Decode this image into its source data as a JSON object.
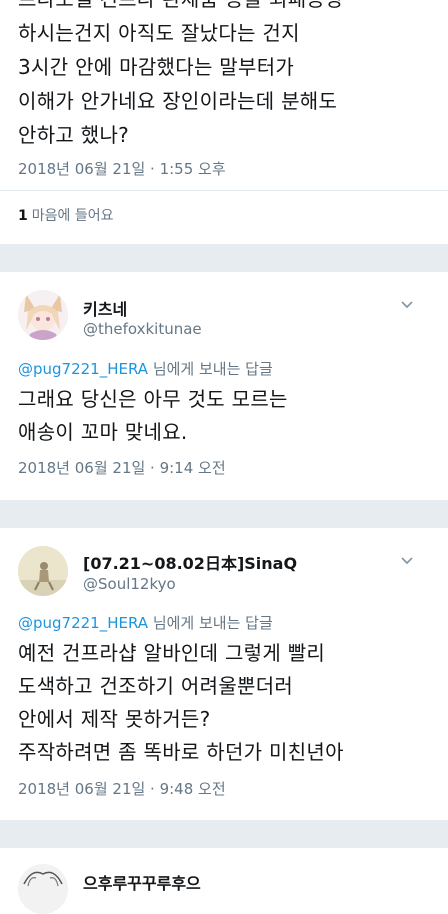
{
  "tweet1": {
    "partial_line": "프라모델 건프라 완제품 용을 외패공방",
    "lines": [
      "하시는건지 아직도 잘났다는 건지",
      "3시간 안에 마감했다는 말부터가",
      "이해가 안가네요 장인이라는데 분해도",
      "안하고 했나?"
    ],
    "timestamp": "2018년 06월 21일 · 1:55 오후",
    "likes_count": "1",
    "likes_label": "마음에 들어요"
  },
  "tweet2": {
    "display_name": "키츠네",
    "handle": "@thefoxkitunae",
    "reply_mention": "@pug7221_HERA",
    "reply_suffix": " 님에게 보내는 답글",
    "lines": [
      "그래요 당신은 아무 것도 모르는",
      "애송이 꼬마 맞네요."
    ],
    "timestamp": "2018년 06월 21일 · 9:14 오전"
  },
  "tweet3": {
    "display_name": "[07.21~08.02日本]SinaQ",
    "handle": "@Soul12kyo",
    "reply_mention": "@pug7221_HERA",
    "reply_suffix": " 님에게 보내는 답글",
    "lines": [
      "예전 건프라샵 알바인데 그렇게 빨리",
      "도색하고 건조하기 어려울뿐더러",
      "안에서 제작 못하거든?",
      "주작하려면 좀 똑바로 하던가 미친년아"
    ],
    "timestamp": "2018년 06월 21일 · 9:48 오전"
  },
  "tweet4": {
    "display_name": "으후루꾸꾸루후으"
  },
  "colors": {
    "text": "#14171a",
    "muted": "#657786",
    "link": "#1b95e0",
    "separator": "#e6ecf0"
  },
  "icons": [
    "chevron-down-icon",
    "avatar"
  ]
}
